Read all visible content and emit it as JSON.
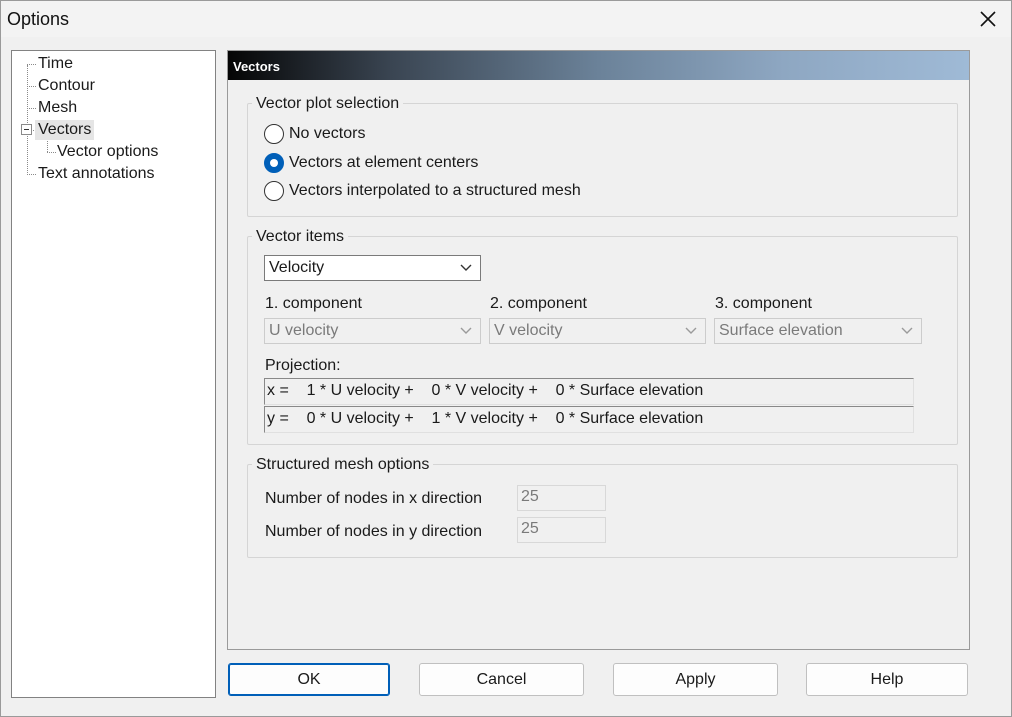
{
  "window": {
    "title": "Options"
  },
  "tree": {
    "items": [
      {
        "label": "Time"
      },
      {
        "label": "Contour"
      },
      {
        "label": "Mesh"
      },
      {
        "label": "Vectors"
      },
      {
        "label": "Vector options"
      },
      {
        "label": "Text annotations"
      }
    ],
    "selected": "Vectors"
  },
  "panel": {
    "header": "Vectors"
  },
  "vector_plot_selection": {
    "title": "Vector plot selection",
    "options": [
      {
        "label": "No vectors",
        "checked": false
      },
      {
        "label": "Vectors at element centers",
        "checked": true
      },
      {
        "label": "Vectors interpolated to a structured mesh",
        "checked": false
      }
    ]
  },
  "vector_items": {
    "title": "Vector items",
    "item_value": "Velocity",
    "components": [
      {
        "label": "1. component",
        "value": "U velocity"
      },
      {
        "label": "2. component",
        "value": "V velocity"
      },
      {
        "label": "3. component",
        "value": "Surface elevation"
      }
    ],
    "projection_label": "Projection:",
    "projection_rows": [
      "x =    1 * U velocity +    0 * V velocity +    0 * Surface elevation",
      "y =    0 * U velocity +    1 * V velocity +    0 * Surface elevation"
    ]
  },
  "structured_mesh": {
    "title": "Structured mesh options",
    "x_label": "Number of nodes in x direction",
    "x_value": "25",
    "y_label": "Number of nodes in y direction",
    "y_value": "25"
  },
  "buttons": {
    "ok": "OK",
    "cancel": "Cancel",
    "apply": "Apply",
    "help": "Help"
  }
}
